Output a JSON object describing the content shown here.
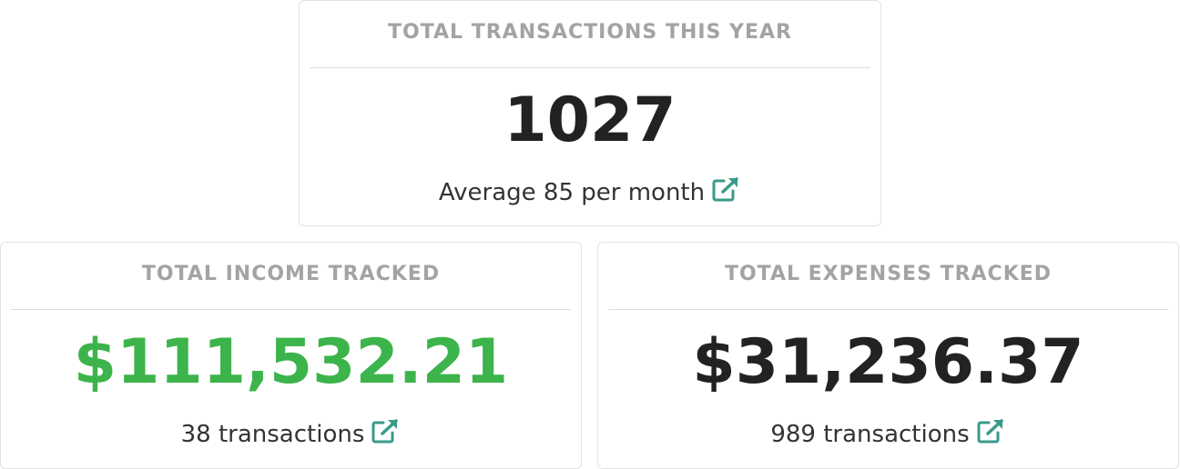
{
  "colors": {
    "title_gray": "#a3a3a3",
    "value_dark": "#222222",
    "income_green": "#3cb44b",
    "link_teal": "#3a9a8a",
    "border": "#e2e2e2"
  },
  "cards": {
    "transactions": {
      "title": "TOTAL TRANSACTIONS THIS YEAR",
      "value": "1027",
      "footer": "Average 85 per month",
      "icon": "external-link-icon"
    },
    "income": {
      "title": "TOTAL INCOME TRACKED",
      "value": "$111,532.21",
      "footer": "38 transactions",
      "icon": "external-link-icon"
    },
    "expenses": {
      "title": "TOTAL EXPENSES TRACKED",
      "value": "$31,236.37",
      "footer": "989 transactions",
      "icon": "external-link-icon"
    }
  }
}
